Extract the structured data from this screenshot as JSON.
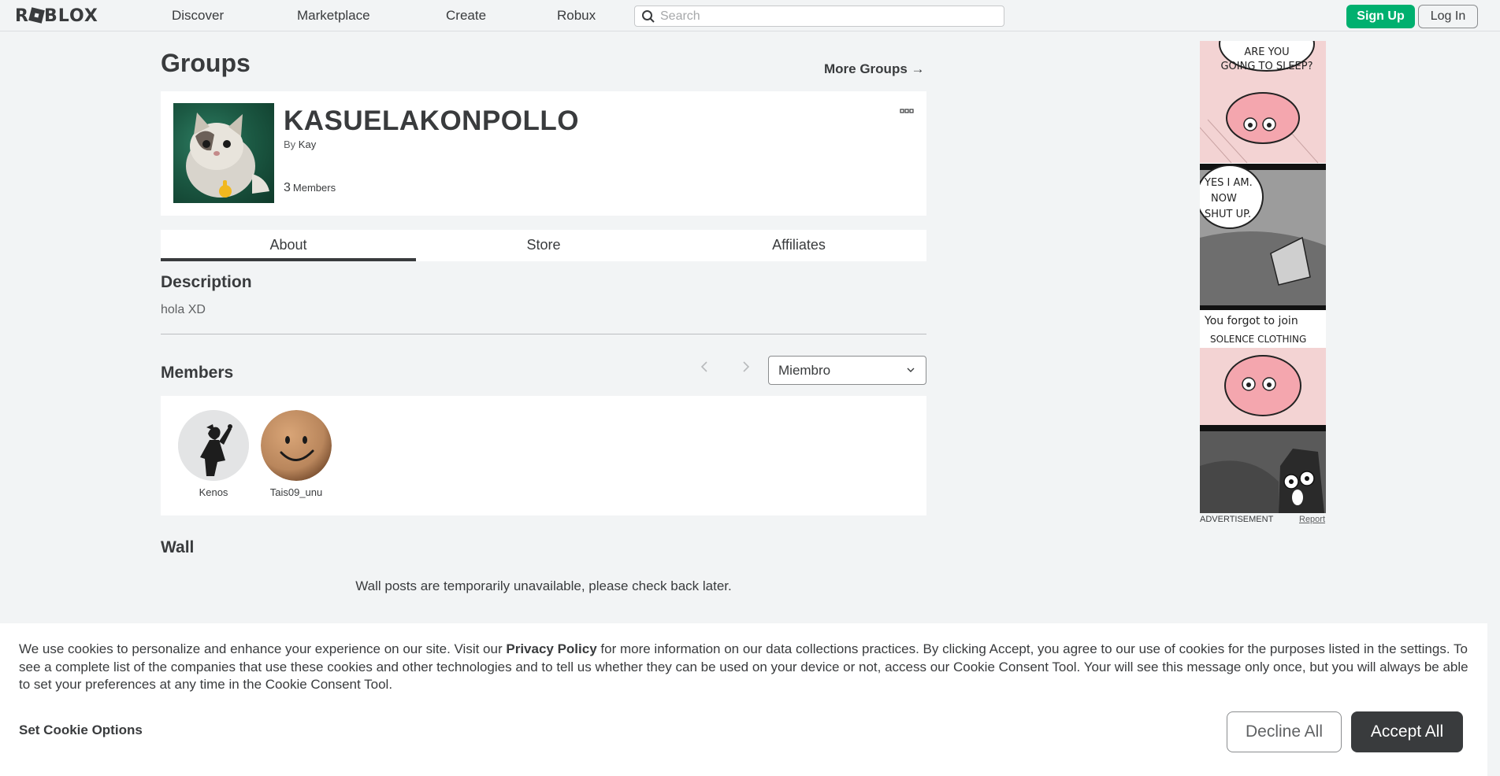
{
  "header": {
    "logo_text": "ROBLOX",
    "nav": [
      "Discover",
      "Marketplace",
      "Create",
      "Robux"
    ],
    "search_placeholder": "Search",
    "signup_label": "Sign Up",
    "login_label": "Log In"
  },
  "page": {
    "title": "Groups",
    "more_groups": "More Groups →"
  },
  "group": {
    "name": "KASUELAKONPOLLO",
    "by_label": "By",
    "owner": "Kay",
    "member_count": "3",
    "member_label": "Members",
    "menu_icon": "ellipsis-icon"
  },
  "tabs": [
    "About",
    "Store",
    "Affiliates"
  ],
  "description": {
    "heading": "Description",
    "text": "hola XD"
  },
  "members": {
    "heading": "Members",
    "role_selected": "Miembro",
    "list": [
      {
        "name": "Kenos"
      },
      {
        "name": "Tais09_unu"
      }
    ]
  },
  "wall": {
    "heading": "Wall",
    "message": "Wall posts are temporarily unavailable, please check back later."
  },
  "ad": {
    "panel1_text1": "ARE YOU",
    "panel1_text2": "GOING TO SLEEP?",
    "panel2_text1": "YES I AM.",
    "panel2_text2": "NOW",
    "panel2_text3": "SHUT UP.",
    "panel3_text1": "You forgot to join",
    "panel3_text2": "SOLENCE CLOTHING",
    "label": "ADVERTISEMENT",
    "report": "Report"
  },
  "cookie": {
    "text_before": "We use cookies to personalize and enhance your experience on our site. Visit our ",
    "link": "Privacy Policy",
    "text_after": " for more information on our data collections practices. By clicking Accept, you agree to our use of cookies for the purposes listed in the settings. To see a complete list of the companies that use these cookies and other technologies and to tell us whether they can be used on your device or not, access our Cookie Consent Tool. Your will see this message only once, but you will always be able to set your preferences at any time in the Cookie Consent Tool.",
    "set_options": "Set Cookie Options",
    "decline": "Decline All",
    "accept": "Accept All"
  },
  "colors": {
    "accent_green": "#00b06f",
    "text_dark": "#393b3d",
    "background": "#f2f4f5"
  }
}
